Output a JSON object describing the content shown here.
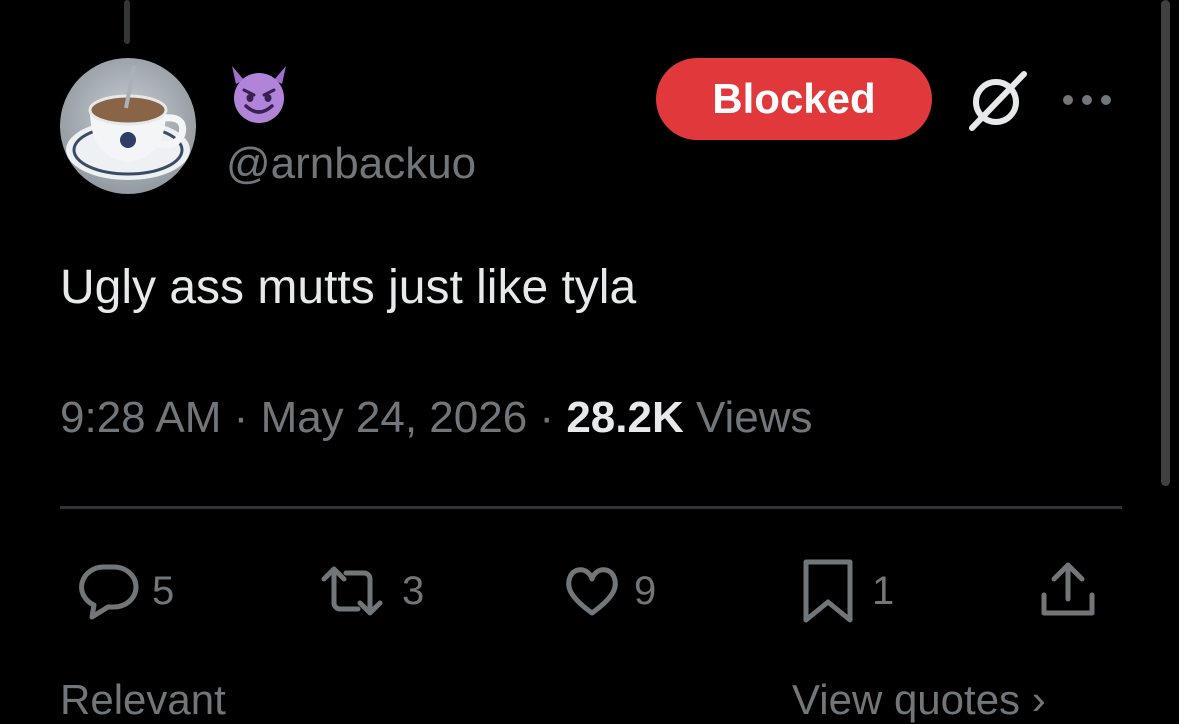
{
  "user": {
    "display_name_emoji": "smiling-devil-emoji",
    "handle": "@arnbackuo",
    "avatar_description_icon": "coffee-cup-avatar"
  },
  "header": {
    "blocked_label": "Blocked",
    "grok_icon": "grok-slash-icon",
    "more_icon": "more-dots-icon"
  },
  "tweet": {
    "text": "Ugly ass mutts just like tyla",
    "time": "9:28 AM",
    "separator": "·",
    "date": "May 24, 2026",
    "views_count": "28.2K",
    "views_label": "Views"
  },
  "actions": {
    "replies": "5",
    "reposts": "3",
    "likes": "9",
    "bookmarks": "1"
  },
  "bottom": {
    "left_tab": "Relevant",
    "right_link": "View quotes ›"
  },
  "colors": {
    "background": "#000000",
    "blocked_red": "#e0383b",
    "muted": "#71767b",
    "text": "#e7e9ea",
    "emoji_purple": "#b084d8"
  }
}
